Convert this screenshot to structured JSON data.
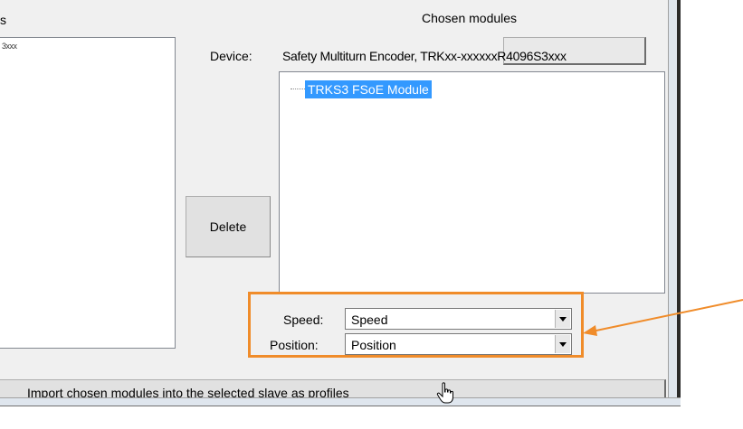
{
  "left_panel": {
    "heading_fragment": "s",
    "list_item": "3xxx"
  },
  "chosen_modules": {
    "title": "Chosen modules",
    "device_label": "Device:",
    "device_value": "Safety Multiturn Encoder, TRKxx-xxxxxxR4096S3xxx",
    "tree_node": "TRKS3 FSoE Module"
  },
  "buttons": {
    "delete": "Delete",
    "import": "Import chosen modules into the selected slave as profiles"
  },
  "fields": {
    "speed_label": "Speed:",
    "speed_value": "Speed",
    "position_label": "Position:",
    "position_value": "Position"
  },
  "colors": {
    "highlight": "#f08c2a",
    "selection": "#3399ff"
  }
}
